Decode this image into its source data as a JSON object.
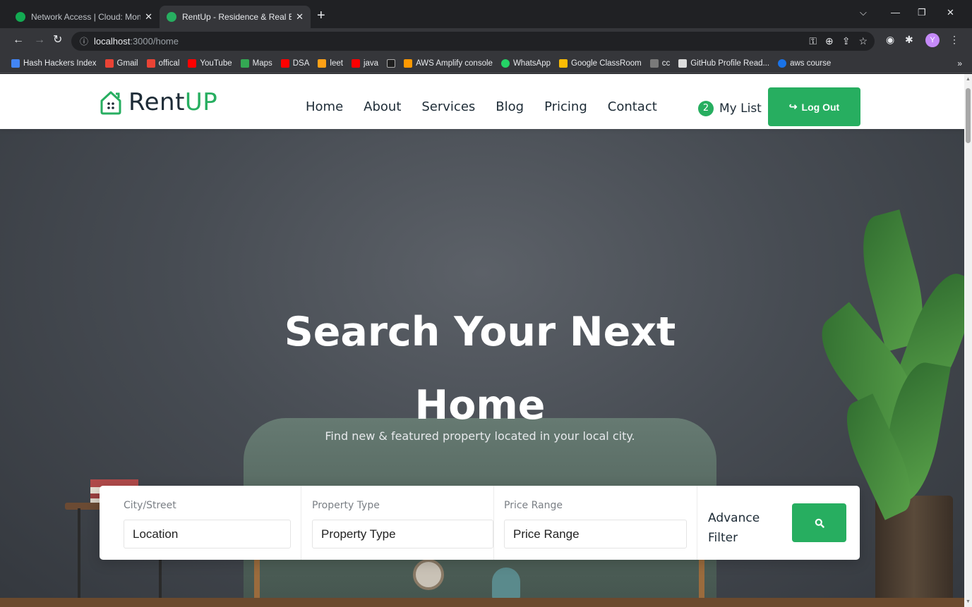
{
  "browser": {
    "tabs": [
      {
        "title": "Network Access | Cloud: MongoD",
        "close": "✕",
        "favicon_color": "#13aa52",
        "active": false
      },
      {
        "title": "RentUp - Residence & Real Estate",
        "close": "✕",
        "favicon_color": "#27ae60",
        "active": true
      }
    ],
    "new_tab": "+",
    "window_controls": {
      "chevron": "⌵",
      "minimize": "—",
      "restore": "❐",
      "close": "✕"
    },
    "address": {
      "host": "localhost",
      "path": ":3000/home"
    },
    "profile_initial": "Y",
    "bookmarks": [
      {
        "label": "Hash Hackers Index",
        "icon_color": "#4285f4"
      },
      {
        "label": "Gmail",
        "icon_color": "#ea4335"
      },
      {
        "label": "offical",
        "icon_color": "#ea4335"
      },
      {
        "label": "YouTube",
        "icon_color": "#ff0000"
      },
      {
        "label": "Maps",
        "icon_color": "#34a853"
      },
      {
        "label": "DSA",
        "icon_color": "#ff0000"
      },
      {
        "label": "leet",
        "icon_color": "#ffa116"
      },
      {
        "label": "java",
        "icon_color": "#ff0000"
      },
      {
        "label": "",
        "icon_color": "#1f1f1f"
      },
      {
        "label": "AWS Amplify console",
        "icon_color": "#ff9900"
      },
      {
        "label": "WhatsApp",
        "icon_color": "#25d366"
      },
      {
        "label": "Google ClassRoom",
        "icon_color": "#fbbc04"
      },
      {
        "label": "cc",
        "icon_color": "#7a7a7a"
      },
      {
        "label": "GitHub Profile Read...",
        "icon_color": "#dddddd"
      },
      {
        "label": "aws course",
        "icon_color": "#1a73e8"
      }
    ],
    "bookmarks_more": "»"
  },
  "site": {
    "logo": {
      "rent": "Rent",
      "up": "UP"
    },
    "nav": [
      "Home",
      "About",
      "Services",
      "Blog",
      "Pricing",
      "Contact"
    ],
    "mylist": {
      "count": "2",
      "label": "My List"
    },
    "logout": {
      "icon": "↪",
      "label": "Log Out"
    },
    "hero": {
      "title_line1": "Search Your Next",
      "title_line2": "Home",
      "subtitle": "Find new & featured property located in your local city."
    },
    "search": {
      "fields": [
        {
          "label": "City/Street",
          "placeholder": "Location"
        },
        {
          "label": "Property Type",
          "placeholder": "Property Type"
        },
        {
          "label": "Price Range",
          "placeholder": "Price Range"
        }
      ],
      "advance_line1": "Advance",
      "advance_line2": "Filter"
    }
  },
  "colors": {
    "brand": "#27ae60",
    "dark": "#1d2b36",
    "browser_bg": "#202124",
    "browser_toolbar": "#35363a"
  }
}
